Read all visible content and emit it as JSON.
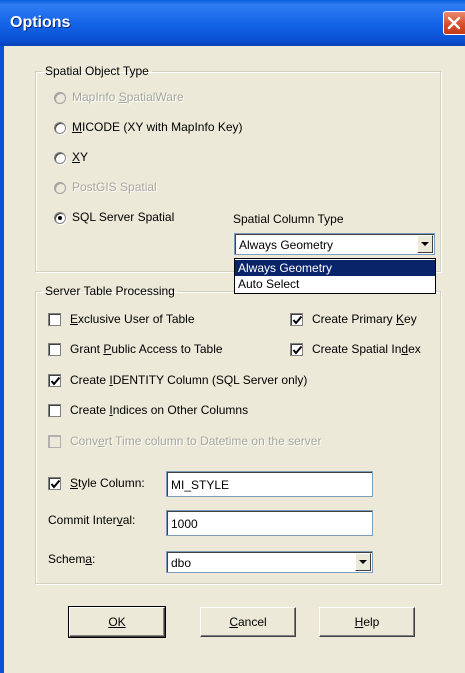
{
  "window": {
    "title": "Options"
  },
  "spatial_object_type": {
    "legend": "Spatial Object Type",
    "options": [
      {
        "label": "MapInfo SpatialWare",
        "selected": false,
        "enabled": false
      },
      {
        "label": "MICODE (XY with MapInfo Key)",
        "selected": false,
        "enabled": true
      },
      {
        "label": "XY",
        "selected": false,
        "enabled": true
      },
      {
        "label": "PostGIS Spatial",
        "selected": false,
        "enabled": false
      },
      {
        "label": "SQL Server Spatial",
        "selected": true,
        "enabled": true
      }
    ],
    "spatial_column_type": {
      "label": "Spatial Column Type",
      "value": "Always Geometry",
      "options": [
        "Always Geometry",
        "Auto Select"
      ],
      "highlighted": "Always Geometry"
    }
  },
  "server_table_processing": {
    "legend": "Server Table Processing",
    "exclusive_user": {
      "label": "Exclusive User of Table",
      "checked": false
    },
    "create_primary_key": {
      "label": "Create Primary Key",
      "checked": true
    },
    "grant_public_access": {
      "label": "Grant Public Access to Table",
      "checked": false
    },
    "create_spatial_index": {
      "label": "Create Spatial Index",
      "checked": true
    },
    "create_identity": {
      "label": "Create IDENTITY Column (SQL Server only)",
      "checked": true
    },
    "create_indices": {
      "label": "Create Indices on Other Columns",
      "checked": false
    },
    "convert_time": {
      "label": "Convert Time column to Datetime on the server",
      "checked": false,
      "enabled": false
    },
    "style_column": {
      "label": "Style Column:",
      "checked": true,
      "value": "MI_STYLE"
    },
    "commit_interval": {
      "label": "Commit Interval:",
      "value": "1000"
    },
    "schema": {
      "label": "Schema:",
      "value": "dbo"
    }
  },
  "buttons": {
    "ok": "OK",
    "cancel": "Cancel",
    "help": "Help"
  },
  "colors": {
    "titlebar": "#0a5fe0",
    "face": "#ece9d8",
    "selection": "#0a246a"
  }
}
